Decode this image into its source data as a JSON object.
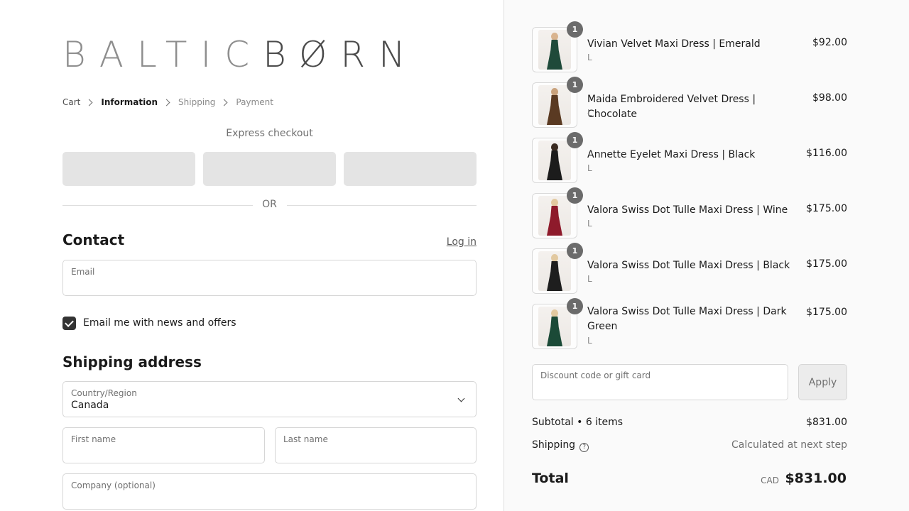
{
  "brand": {
    "part1": "BALTIC",
    "part2": "BØRN"
  },
  "breadcrumb": [
    {
      "label": "Cart",
      "state": "link"
    },
    {
      "label": "Information",
      "state": "active"
    },
    {
      "label": "Shipping",
      "state": "muted"
    },
    {
      "label": "Payment",
      "state": "muted"
    }
  ],
  "express": {
    "title": "Express checkout",
    "divider": "OR"
  },
  "contact": {
    "heading": "Contact",
    "login_link": "Log in",
    "email_label": "Email",
    "email_value": "",
    "newsletter_label": "Email me with news and offers",
    "newsletter_checked": true
  },
  "shipping_address": {
    "heading": "Shipping address",
    "country_label": "Country/Region",
    "country_value": "Canada",
    "first_name_label": "First name",
    "last_name_label": "Last name",
    "company_label": "Company (optional)"
  },
  "cart": {
    "items": [
      {
        "name": "Vivian Velvet Maxi Dress | Emerald",
        "size": "L",
        "price": "$92.00",
        "qty": "1",
        "color": "#1f4a3a"
      },
      {
        "name": "Maida Embroidered Velvet Dress | Chocolate",
        "size": "L",
        "price": "$98.00",
        "qty": "1",
        "color": "#5a3a22"
      },
      {
        "name": "Annette Eyelet Maxi Dress | Black",
        "size": "L",
        "price": "$116.00",
        "qty": "1",
        "color": "#1c1c1c"
      },
      {
        "name": "Valora Swiss Dot Tulle Maxi Dress | Wine",
        "size": "L",
        "price": "$175.00",
        "qty": "1",
        "color": "#8e1a2b"
      },
      {
        "name": "Valora Swiss Dot Tulle Maxi Dress | Black",
        "size": "L",
        "price": "$175.00",
        "qty": "1",
        "color": "#1e1e1e"
      },
      {
        "name": "Valora Swiss Dot Tulle Maxi Dress | Dark Green",
        "size": "L",
        "price": "$175.00",
        "qty": "1",
        "color": "#1b4a37"
      }
    ]
  },
  "discount": {
    "placeholder": "Discount code or gift card",
    "button": "Apply"
  },
  "summary": {
    "subtotal_label": "Subtotal • 6 items",
    "subtotal_value": "$831.00",
    "shipping_label": "Shipping",
    "shipping_value": "Calculated at next step",
    "total_label": "Total",
    "currency": "CAD",
    "total_value": "$831.00"
  },
  "icons": {
    "help": "question-circle-icon",
    "check": "checkmark-icon",
    "select": "chevron-down-icon"
  }
}
